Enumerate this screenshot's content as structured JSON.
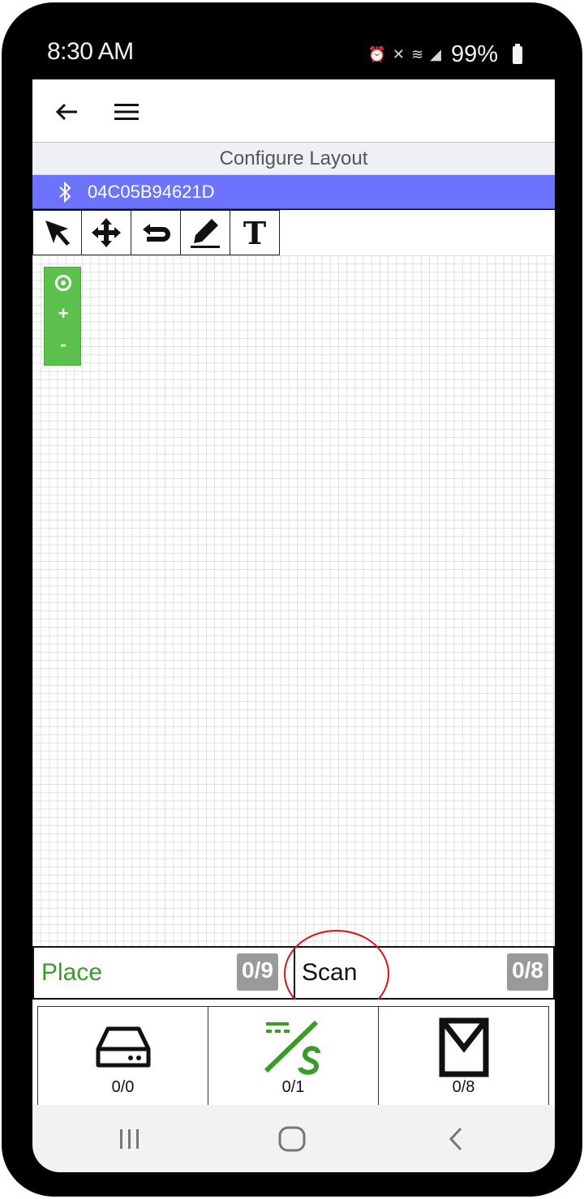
{
  "status_bar": {
    "time": "8:30 AM",
    "battery": "99%",
    "icons": [
      "alarm-icon",
      "mute-icon",
      "wifi-icon",
      "signal-icon",
      "battery-icon"
    ]
  },
  "app_bar": {
    "back_icon": "arrow-left-icon",
    "menu_icon": "hamburger-menu-icon"
  },
  "page": {
    "title": "Configure Layout",
    "device_id": "04C05B94621D",
    "device_icon": "bluetooth-icon",
    "colors": {
      "device_bar": "#6b73ff",
      "zoom_panel": "#5cc04c",
      "place_text": "#3a9a2a",
      "highlight_circle": "#d8141a"
    }
  },
  "toolbar": {
    "tools": [
      {
        "name": "select",
        "icon": "cursor-arrow-icon"
      },
      {
        "name": "move",
        "icon": "move-arrows-icon"
      },
      {
        "name": "undo",
        "icon": "undo-icon"
      },
      {
        "name": "draw",
        "icon": "pencil-icon"
      },
      {
        "name": "text",
        "icon": "text-tool-icon",
        "glyph": "T"
      }
    ]
  },
  "zoom": {
    "center_icon": "target-icon",
    "zoom_in": "+",
    "zoom_out": "-"
  },
  "place_scan": {
    "place_label": "Place",
    "place_count": "0/9",
    "scan_label": "Scan",
    "scan_count": "0/8"
  },
  "tiles": [
    {
      "icon": "hard-drive-icon",
      "count": "0/0"
    },
    {
      "icon": "wire-sensor-icon",
      "count": "0/1"
    },
    {
      "icon": "envelope-box-icon",
      "count": "0/8"
    }
  ],
  "nav": {
    "recents_icon": "recents-icon",
    "home_icon": "home-icon",
    "back_icon": "back-chevron-icon"
  }
}
